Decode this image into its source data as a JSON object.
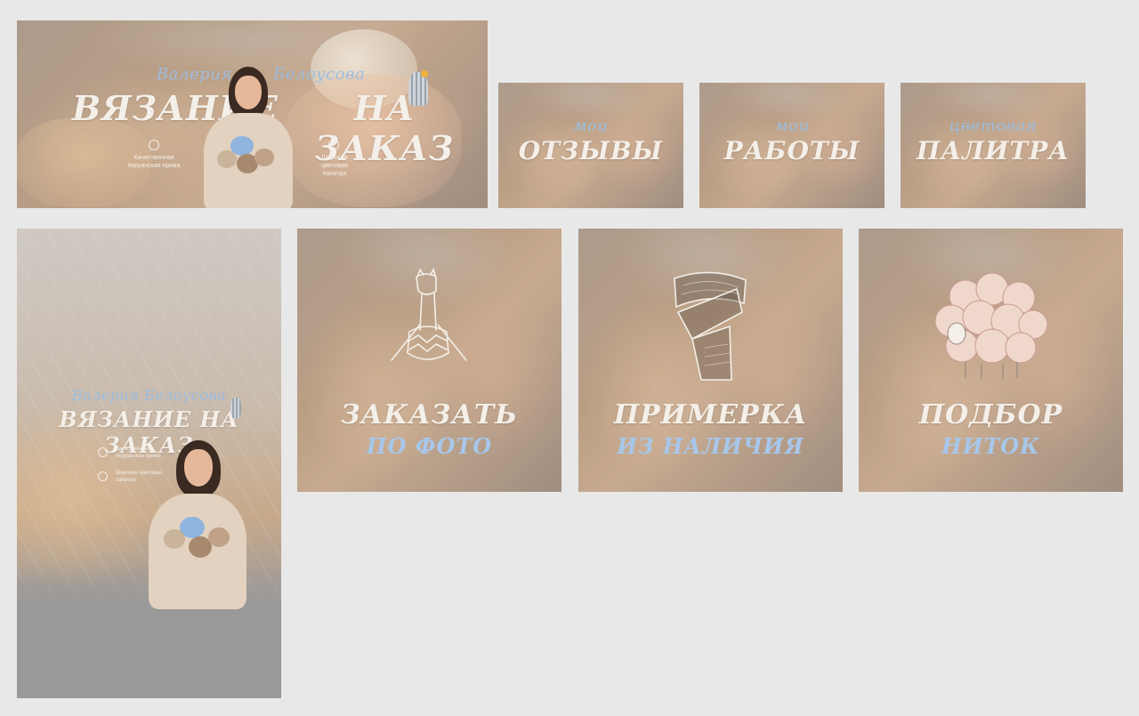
{
  "banner": {
    "first_name": "Валерия",
    "last_name": "Белоусова",
    "title_left": "ВЯЗАНИЕ",
    "title_right": "НА ЗАКАЗ",
    "feature1": "Качественная перуанская пряжа",
    "feature2": "Широкая цветовая палитра"
  },
  "small_cards": [
    {
      "script": "мои",
      "title": "ОТЗЫВЫ"
    },
    {
      "script": "мои",
      "title": "РАБОТЫ"
    },
    {
      "script": "цветовая",
      "title": "ПАЛИТРА"
    }
  ],
  "vertical": {
    "name": "Валерия Белоусова",
    "title": "ВЯЗАНИЕ НА ЗАКАЗ",
    "feature1": "Качественная перуанская пряжа",
    "feature2": "Широкая цветовая палитра"
  },
  "square_cards": [
    {
      "icon": "llama-knitting-icon",
      "line1": "ЗАКАЗАТЬ",
      "line2": "ПО ФОТО"
    },
    {
      "icon": "scarf-icon",
      "line1": "ПРИМЕРКА",
      "line2": "ИЗ НАЛИЧИЯ"
    },
    {
      "icon": "sheep-yarn-icon",
      "line1": "ПОДБОР",
      "line2": "НИТОК"
    }
  ],
  "colors": {
    "page_bg": "#e8e8e8",
    "accent_blue": "#9cbde0",
    "cream": "#f4efe8"
  }
}
